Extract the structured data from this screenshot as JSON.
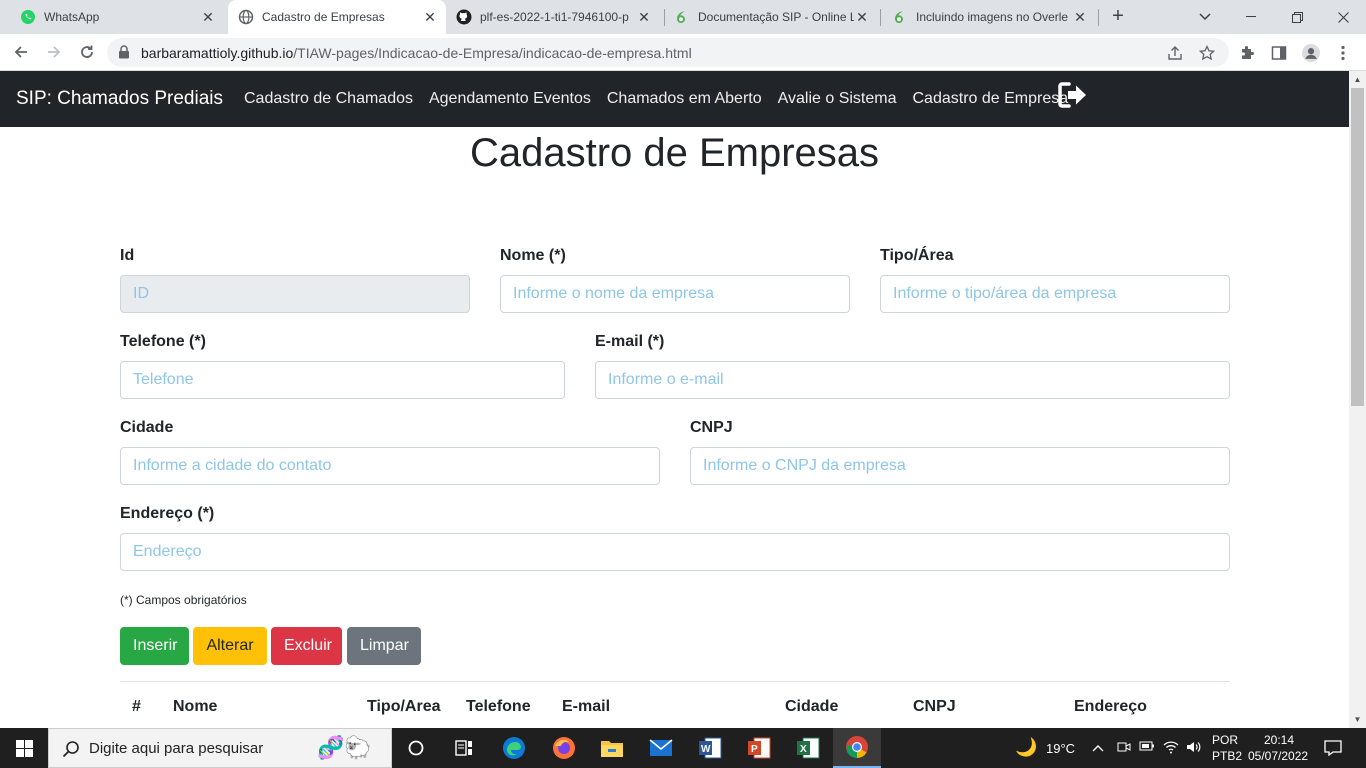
{
  "browser": {
    "tabs": [
      {
        "title": "WhatsApp",
        "icon": "whatsapp-icon",
        "active": false
      },
      {
        "title": "Cadastro de Empresas",
        "icon": "globe-icon",
        "active": true
      },
      {
        "title": "plf-es-2022-1-ti1-7946100-p",
        "icon": "github-icon",
        "active": false
      },
      {
        "title": "Documentação SIP - Online L",
        "icon": "overleaf-icon",
        "active": false
      },
      {
        "title": "Incluindo imagens no Overle",
        "icon": "overleaf-icon",
        "active": false
      }
    ],
    "url_host": "barbaramattioly.github.io",
    "url_path": "/TIAW-pages/Indicacao-de-Empresa/indicacao-de-empresa.html"
  },
  "navbar": {
    "brand": "SIP: Chamados Prediais",
    "links": [
      "Cadastro de Chamados",
      "Agendamento Eventos",
      "Chamados em Aberto",
      "Avalie o Sistema",
      "Cadastro de Empresa"
    ]
  },
  "page": {
    "title": "Cadastro de Empresas"
  },
  "form": {
    "id_label": "Id",
    "id_placeholder": "ID",
    "nome_label": "Nome (*)",
    "nome_placeholder": "Informe o nome da empresa",
    "tipo_label": "Tipo/Área",
    "tipo_placeholder": "Informe o tipo/área da empresa",
    "telefone_label": "Telefone (*)",
    "telefone_placeholder": "Telefone",
    "email_label": "E-mail (*)",
    "email_placeholder": "Informe o e-mail",
    "cidade_label": "Cidade",
    "cidade_placeholder": "Informe a cidade do contato",
    "cnpj_label": "CNPJ",
    "cnpj_placeholder": "Informe o CNPJ da empresa",
    "endereco_label": "Endereço (*)",
    "endereco_placeholder": "Endereço",
    "required_note": "(*) Campos obrigatórios"
  },
  "buttons": {
    "insert": "Inserir",
    "alter": "Alterar",
    "delete": "Excluir",
    "clear": "Limpar"
  },
  "table": {
    "headers": [
      "#",
      "Nome",
      "Tipo/Area",
      "Telefone",
      "E-mail",
      "Cidade",
      "CNPJ",
      "Endereço"
    ]
  },
  "taskbar": {
    "search_placeholder": "Digite aqui para pesquisar",
    "temperature": "19°C",
    "lang_top": "POR",
    "lang_bottom": "PTB2",
    "time": "20:14",
    "date": "05/07/2022"
  },
  "colors": {
    "navbar_bg": "#212529",
    "btn_insert": "#28a745",
    "btn_alter": "#ffc107",
    "btn_delete": "#dc3545",
    "btn_clear": "#6c757d",
    "placeholder": "#8ec6e8"
  }
}
